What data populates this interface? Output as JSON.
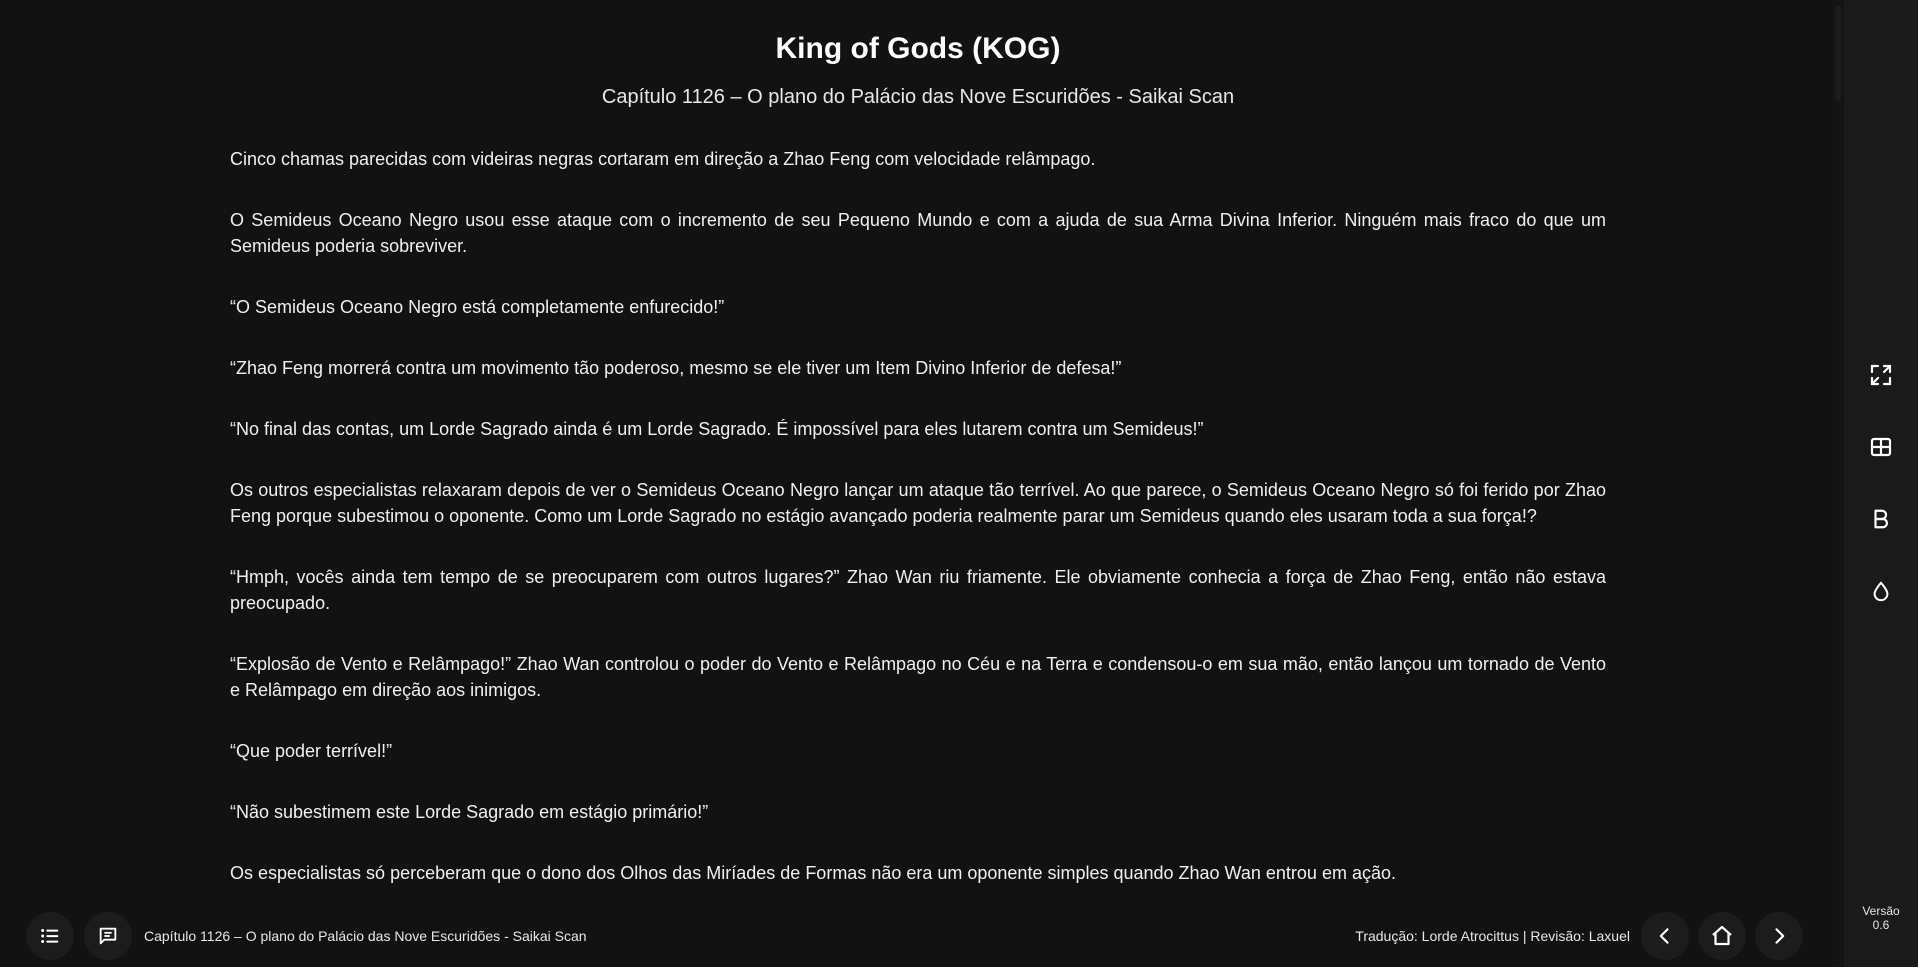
{
  "novel": {
    "title": "King of Gods (KOG)",
    "chapter": "Capítulo 1126 – O plano do Palácio das Nove Escuridões - Saikai Scan"
  },
  "paragraphs": [
    "Cinco chamas parecidas com videiras negras cortaram em direção a Zhao Feng com velocidade relâmpago.",
    "O Semideus Oceano Negro usou esse ataque com o incremento de seu Pequeno Mundo e com a ajuda de sua Arma Divina Inferior. Ninguém mais fraco do que um Semideus poderia sobreviver.",
    "“O Semideus Oceano Negro está completamente enfurecido!”",
    "“Zhao Feng morrerá contra um movimento tão poderoso, mesmo se ele tiver um Item Divino Inferior de defesa!”",
    "“No final das contas, um Lorde Sagrado ainda é um Lorde Sagrado. É impossível para eles lutarem contra um Semideus!”",
    "Os outros especialistas relaxaram depois de ver o Semideus Oceano Negro lançar um ataque tão terrível. Ao que parece, o Semideus Oceano Negro só foi ferido por Zhao Feng porque subestimou o oponente. Como um Lorde Sagrado no estágio avançado poderia realmente parar um Semideus quando eles usaram toda a sua força!?",
    "“Hmph, vocês ainda tem tempo de se preocuparem com outros lugares?” Zhao Wan riu friamente. Ele obviamente conhecia a força de Zhao Feng, então não estava preocupado.",
    "“Explosão de Vento e Relâmpago!” Zhao Wan controlou o poder do Vento e Relâmpago no Céu e na Terra e condensou-o em sua mão, então lançou um tornado de Vento e Relâmpago em direção aos inimigos.",
    "“Que poder terrível!”",
    "“Não subestimem este Lorde Sagrado em estágio primário!”",
    "Os especialistas só perceberam que o dono dos Olhos das Miríades de Formas não era um oponente simples quando Zhao Wan entrou em ação."
  ],
  "bottom_bar": {
    "chapter_label": "Capítulo 1126 – O plano do Palácio das Nove Escuridões - Saikai Scan",
    "credits": "Tradução: Lorde Atrocittus | Revisão: Laxuel"
  },
  "side_rail": {
    "version_label": "Versão",
    "version_number": "0.6",
    "buttons": [
      "fullscreen-icon",
      "layout-icon",
      "bold-icon",
      "drop-icon"
    ]
  },
  "colors": {
    "background": "#121212",
    "rail": "#1a1a1a",
    "text": "#f0f0f0"
  }
}
